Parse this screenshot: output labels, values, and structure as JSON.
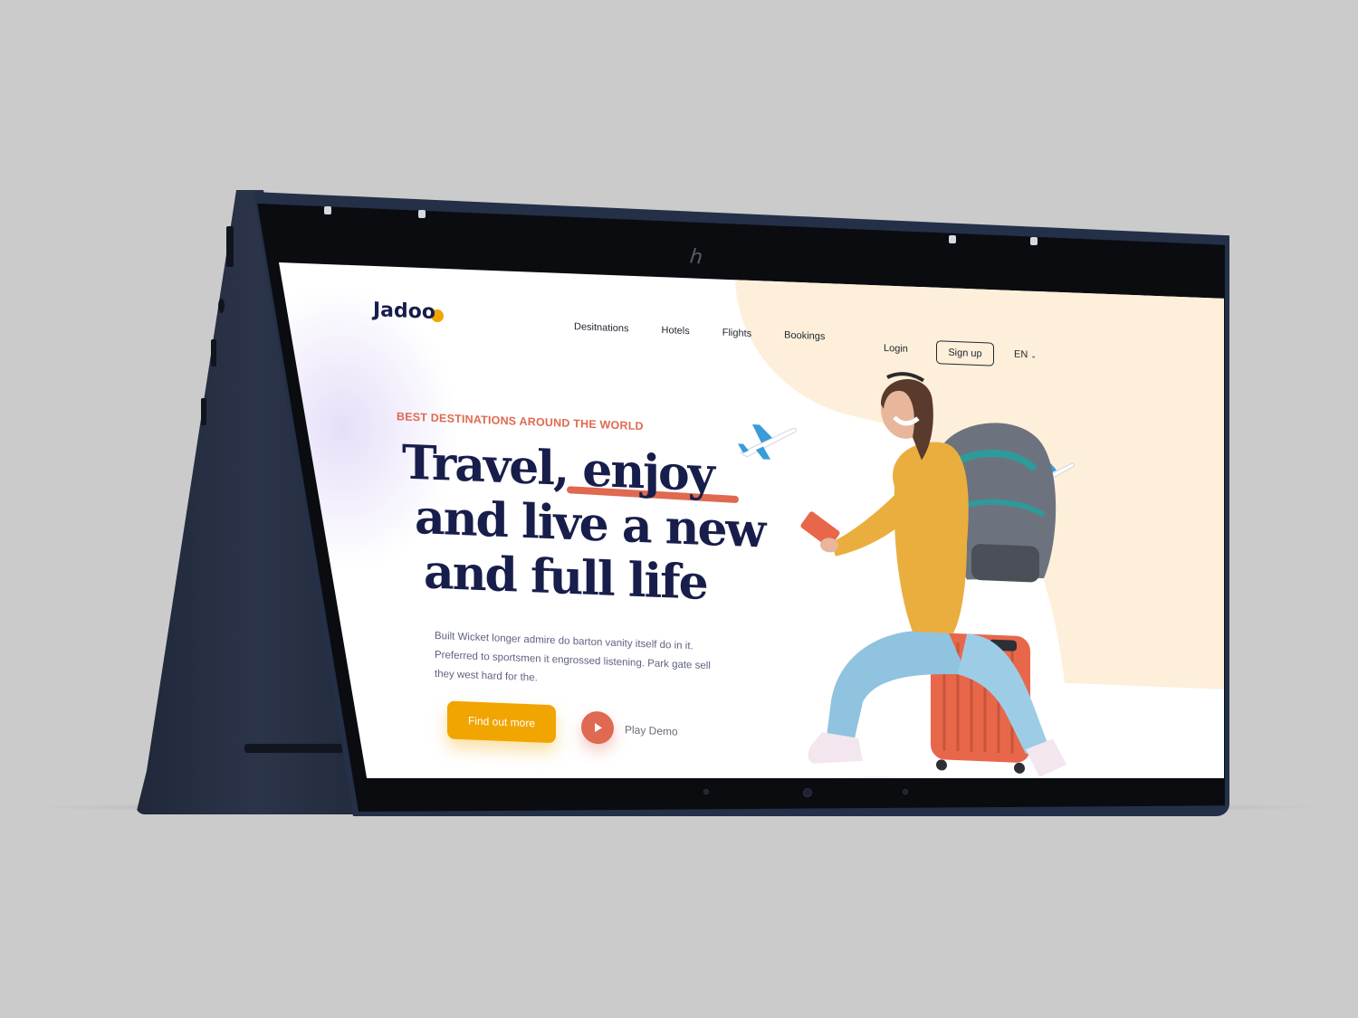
{
  "brand": {
    "name_prefix": "Jad",
    "name_suffix": "oo",
    "accent": "#f1a501",
    "secondary": "#df6951",
    "navy": "#181e4b"
  },
  "nav": {
    "items": [
      {
        "label": "Desitnations"
      },
      {
        "label": "Hotels"
      },
      {
        "label": "Flights"
      },
      {
        "label": "Bookings"
      }
    ],
    "login": "Login",
    "signup": "Sign up",
    "language": "EN"
  },
  "hero": {
    "tagline": "BEST DESTINATIONS AROUND THE WORLD",
    "headline_line1": "Travel, enjoy",
    "headline_line2": "and live a new",
    "headline_line3": "and full life",
    "description": "Built Wicket longer admire do barton vanity itself do in it. Preferred to sportsmen it engrossed listening. Park gate sell they west hard for the.",
    "cta_primary": "Find out more",
    "cta_secondary": "Play Demo"
  },
  "icons": {
    "play": "play-icon",
    "chevron": "chevron-down-icon",
    "plane": "airplane-icon"
  }
}
